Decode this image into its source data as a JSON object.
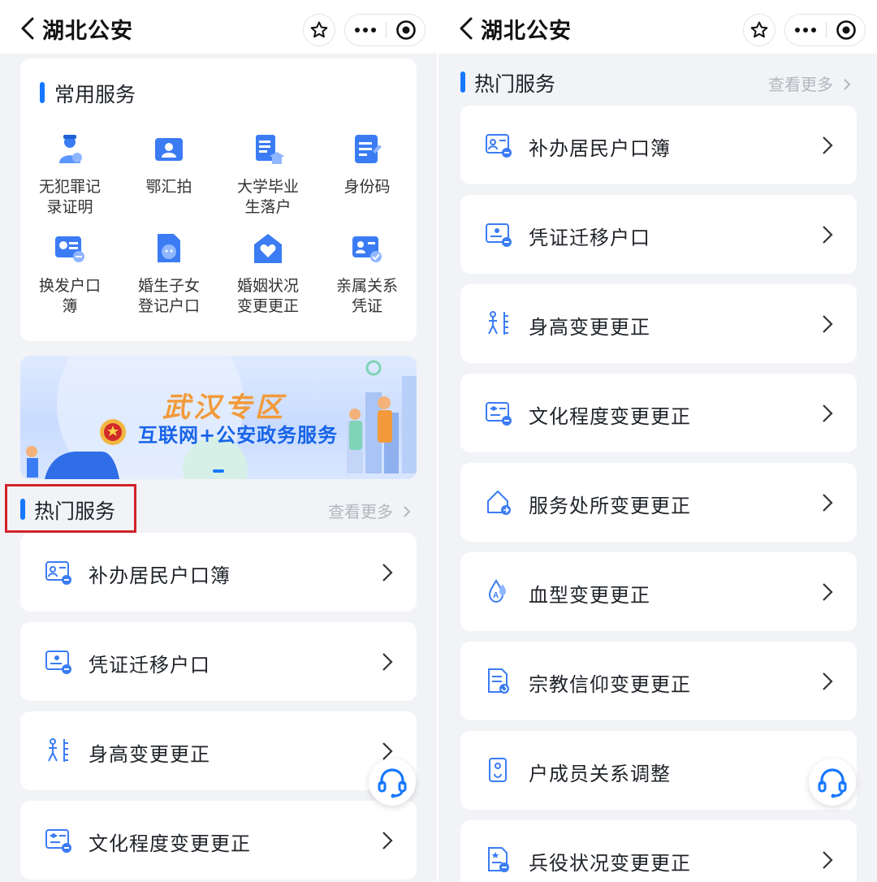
{
  "left": {
    "header": {
      "title": "湖北公安"
    },
    "common": {
      "title": "常用服务",
      "items": [
        {
          "label": "无犯罪记\n录证明",
          "icon": "police-officer-icon"
        },
        {
          "label": "鄂汇拍",
          "icon": "portrait-photo-icon"
        },
        {
          "label": "大学毕业\n生落户",
          "icon": "graduation-document-icon"
        },
        {
          "label": "身份码",
          "icon": "id-code-icon"
        },
        {
          "label": "换发户口\n簿",
          "icon": "household-book-icon"
        },
        {
          "label": "婚生子女\n登记户口",
          "icon": "child-registration-icon"
        },
        {
          "label": "婚姻状况\n变更更正",
          "icon": "marriage-heart-icon"
        },
        {
          "label": "亲属关系\n凭证",
          "icon": "kinship-certificate-icon"
        }
      ]
    },
    "banner": {
      "line1": "武汉专区",
      "line2": "互联网+公安政务服务"
    },
    "hot": {
      "title": "热门服务",
      "more": "查看更多"
    },
    "rows": [
      {
        "label": "补办居民户口簿",
        "icon": "household-card-icon"
      },
      {
        "label": "凭证迁移户口",
        "icon": "migration-certificate-icon"
      },
      {
        "label": "身高变更更正",
        "icon": "height-ruler-icon"
      },
      {
        "label": "文化程度变更更正",
        "icon": "education-card-icon"
      }
    ]
  },
  "right": {
    "header": {
      "title": "湖北公安"
    },
    "hot": {
      "title": "热门服务",
      "more": "查看更多"
    },
    "rows": [
      {
        "label": "补办居民户口簿",
        "icon": "household-card-icon"
      },
      {
        "label": "凭证迁移户口",
        "icon": "migration-certificate-icon"
      },
      {
        "label": "身高变更更正",
        "icon": "height-ruler-icon"
      },
      {
        "label": "文化程度变更更正",
        "icon": "education-card-icon"
      },
      {
        "label": "服务处所变更更正",
        "icon": "workplace-house-icon"
      },
      {
        "label": "血型变更更正",
        "icon": "blood-drop-icon"
      },
      {
        "label": "宗教信仰变更更正",
        "icon": "religion-document-icon"
      },
      {
        "label": "户成员关系调整",
        "icon": "member-relation-icon"
      },
      {
        "label": "兵役状况变更更正",
        "icon": "military-service-icon"
      }
    ]
  },
  "colors": {
    "accent": "#1677ff",
    "highlight": "#d2222a",
    "banner_orange": "#f29a3a"
  }
}
